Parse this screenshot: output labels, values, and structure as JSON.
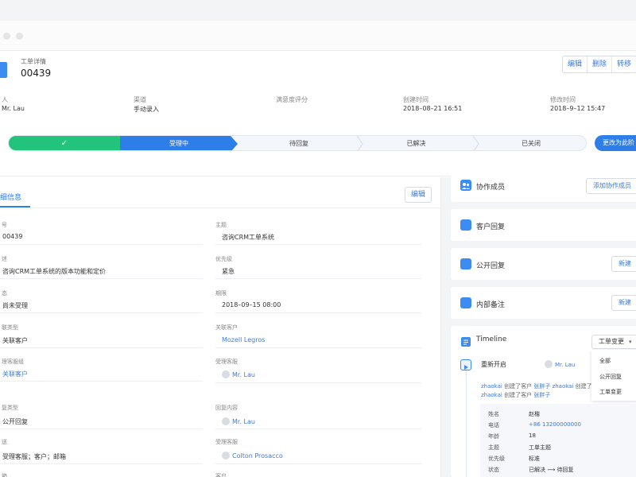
{
  "ticket": {
    "label": "工单详情",
    "id": "00439",
    "actions": [
      "编辑",
      "删除",
      "转移"
    ]
  },
  "meta": [
    {
      "label": "人",
      "value": "Mr. Lau"
    },
    {
      "label": "渠道",
      "value": "手动录入"
    },
    {
      "label": "满意度评分",
      "value": ""
    },
    {
      "label": "创建时间",
      "value": "2018–08–21 16:51"
    },
    {
      "label": "修改时间",
      "value": "2018–9–12 15:47"
    }
  ],
  "steps": {
    "done_mark": "✓",
    "items": [
      "受理中",
      "待回复",
      "已解决",
      "已关闭"
    ],
    "change_button": "更改为此阶"
  },
  "details": {
    "tab_label": "细信息",
    "edit_label": "编辑",
    "left_fields": [
      {
        "label": "号",
        "value": "00439"
      },
      {
        "label": "述",
        "value": "咨询CRM工单系统的版本功能和定价"
      },
      {
        "label": "态",
        "value": "尚未受理"
      },
      {
        "label": "联类型",
        "value": "关联客户"
      },
      {
        "label": "理客服组",
        "value": "关联客户"
      },
      {
        "label": "复类型",
        "value": "公开回复"
      },
      {
        "label": "送",
        "value": "受理客服；客户；邮箱"
      },
      {
        "label": "箱",
        "value": ""
      }
    ],
    "right_fields": [
      {
        "label": "主题",
        "value": "咨询CRM工单系统"
      },
      {
        "label": "优先级",
        "value": "紧急"
      },
      {
        "label": "期限",
        "value": "2018–09–15 08:00"
      },
      {
        "label": "关联客户",
        "value": "Mozell Legros"
      },
      {
        "label": "受理客服",
        "value": "Mr. Lau"
      },
      {
        "label": "回复内容",
        "value": "Mr. Lau"
      },
      {
        "label": "受理客服",
        "value": "Colton Prosacco"
      },
      {
        "label": "客户",
        "value": "Mr. Lau"
      }
    ]
  },
  "side": {
    "collab_title": "协作成员",
    "collab_button": "添加协作成员",
    "customer_reply_title": "客户回复",
    "public_reply_title": "公开回复",
    "internal_note_title": "内部备注",
    "new_button": "新建",
    "timeline_title": "Timeline",
    "dropdown_value": "工单变更",
    "dropdown_options": [
      "全部",
      "公开回复",
      "工单变更"
    ]
  },
  "timeline": {
    "event": "重新开启",
    "event_user": "Mr. Lau",
    "line1": {
      "actor": "zhaokai",
      "verb": "创建了客户",
      "target": "张胖子",
      "actor2": "zhaokai",
      "verb2": "创建了"
    },
    "line2": {
      "actor": "zhaokai",
      "verb": "创建了客户",
      "target": "张胖子"
    },
    "fields": [
      {
        "k": "姓名",
        "v": "赵楷"
      },
      {
        "k": "电话",
        "v": "+86 13200000000"
      },
      {
        "k": "年龄",
        "v": "18"
      },
      {
        "k": "主题",
        "v": "工单主题"
      },
      {
        "k": "优先级",
        "v": "标准"
      },
      {
        "k": "状态",
        "v": "已解决"
      }
    ],
    "status_to": "待回复"
  },
  "colors": {
    "primary": "#2e7eea",
    "success": "#22c47b",
    "link": "#3d7bd6"
  }
}
